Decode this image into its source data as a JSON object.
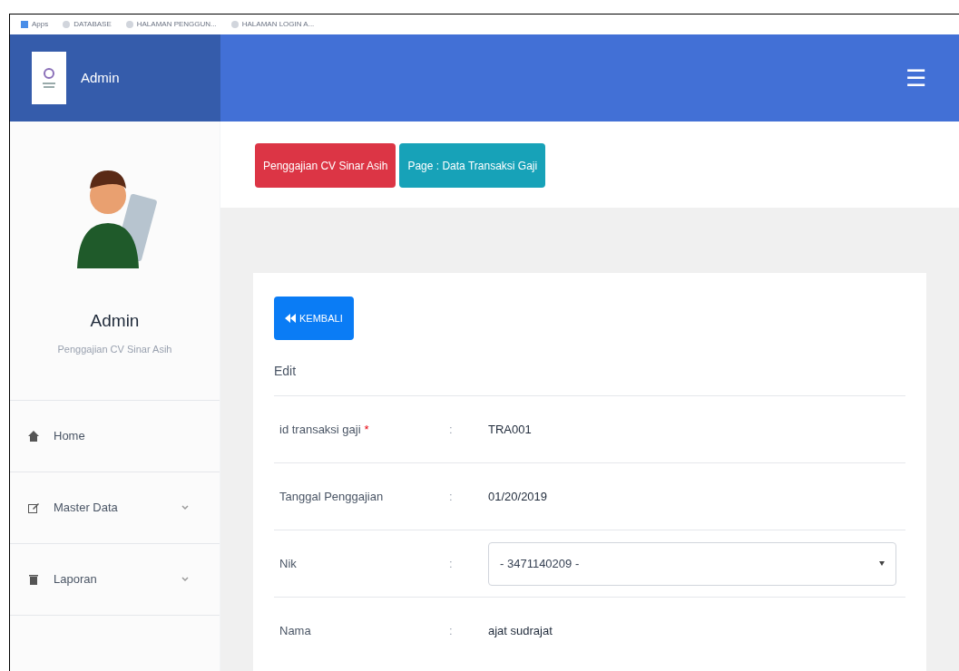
{
  "bookmarks_bar": [
    {
      "kind": "apps",
      "label": "Apps"
    },
    {
      "kind": "page",
      "label": "DATABASE"
    },
    {
      "kind": "page",
      "label": "HALAMAN PENGGUN..."
    },
    {
      "kind": "page",
      "label": "HALAMAN LOGIN A..."
    }
  ],
  "header": {
    "brand": "Admin",
    "menu_toggle": "☰"
  },
  "sidebar": {
    "user_name": "Admin",
    "user_role": "Penggajian CV Sinar Asih",
    "items": [
      {
        "label": "Home",
        "kind": "link"
      },
      {
        "label": "Master Data",
        "kind": "dropdown"
      },
      {
        "label": "Laporan",
        "kind": "dropdown"
      }
    ]
  },
  "breadcrumb": [
    {
      "label": "Penggajian CV Sinar Asih",
      "kind": "danger"
    },
    {
      "label": "Page : Data Transaksi Gaji",
      "kind": "info"
    }
  ],
  "card": {
    "back_button": "KEMBALI",
    "section_title": "Edit",
    "fields": [
      {
        "label": "id transaksi gaji",
        "required_mark": "*",
        "separator": ":",
        "kind": "text",
        "value": "TRA001"
      },
      {
        "label": "Tanggal Penggajian",
        "separator": ":",
        "kind": "text",
        "value": "01/20/2019"
      },
      {
        "label": "Nik",
        "separator": ":",
        "kind": "select",
        "value": "- 3471140209 -"
      },
      {
        "label": "Nama",
        "separator": ":",
        "kind": "text",
        "value": "ajat sudrajat"
      }
    ]
  }
}
